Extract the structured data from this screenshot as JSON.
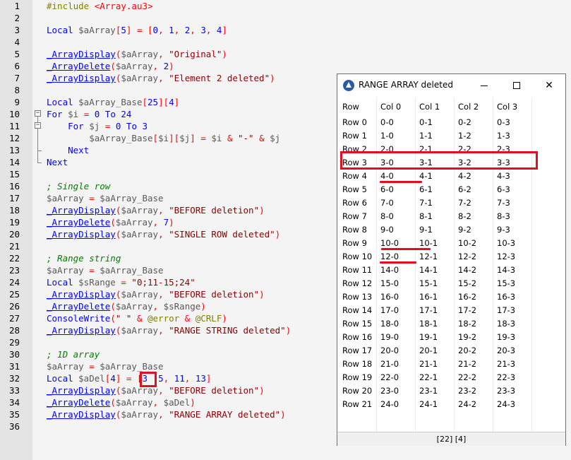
{
  "editor": {
    "lines": [
      [
        [
          "inc",
          "#include "
        ],
        [
          "str",
          "<Array.au3>"
        ]
      ],
      [],
      [
        [
          "kw",
          "Local "
        ],
        [
          "var",
          "$aArray"
        ],
        [
          "op",
          "["
        ],
        [
          "num",
          "5"
        ],
        [
          "op",
          "] = ["
        ],
        [
          "num",
          "0"
        ],
        [
          "op",
          ", "
        ],
        [
          "num",
          "1"
        ],
        [
          "op",
          ", "
        ],
        [
          "num",
          "2"
        ],
        [
          "op",
          ", "
        ],
        [
          "num",
          "3"
        ],
        [
          "op",
          ", "
        ],
        [
          "num",
          "4"
        ],
        [
          "op",
          "]"
        ]
      ],
      [],
      [
        [
          "fn",
          "_ArrayDisplay"
        ],
        [
          "op",
          "("
        ],
        [
          "var",
          "$aArray"
        ],
        [
          "op",
          ", "
        ],
        [
          "strd",
          "\"Original\""
        ],
        [
          "op",
          ")"
        ]
      ],
      [
        [
          "fn",
          "_ArrayDelete"
        ],
        [
          "op",
          "("
        ],
        [
          "var",
          "$aArray"
        ],
        [
          "op",
          ", "
        ],
        [
          "num",
          "2"
        ],
        [
          "op",
          ")"
        ]
      ],
      [
        [
          "fn",
          "_ArrayDisplay"
        ],
        [
          "op",
          "("
        ],
        [
          "var",
          "$aArray"
        ],
        [
          "op",
          ", "
        ],
        [
          "strd",
          "\"Element 2 deleted\""
        ],
        [
          "op",
          ")"
        ]
      ],
      [],
      [
        [
          "kw",
          "Local "
        ],
        [
          "var",
          "$aArray_Base"
        ],
        [
          "op",
          "["
        ],
        [
          "num",
          "25"
        ],
        [
          "op",
          "]["
        ],
        [
          "num",
          "4"
        ],
        [
          "op",
          "]"
        ]
      ],
      [
        [
          "kw",
          "For "
        ],
        [
          "var",
          "$i"
        ],
        [
          "op",
          " = "
        ],
        [
          "num",
          "0"
        ],
        [
          "kw",
          " To "
        ],
        [
          "num",
          "24"
        ]
      ],
      [
        [
          "plain",
          "    "
        ],
        [
          "kw",
          "For "
        ],
        [
          "var",
          "$j"
        ],
        [
          "op",
          " = "
        ],
        [
          "num",
          "0"
        ],
        [
          "kw",
          " To "
        ],
        [
          "num",
          "3"
        ]
      ],
      [
        [
          "plain",
          "        "
        ],
        [
          "var",
          "$aArray_Base"
        ],
        [
          "op",
          "["
        ],
        [
          "var",
          "$i"
        ],
        [
          "op",
          "]["
        ],
        [
          "var",
          "$j"
        ],
        [
          "op",
          "] = "
        ],
        [
          "var",
          "$i"
        ],
        [
          "op",
          " & "
        ],
        [
          "strd",
          "\"-\""
        ],
        [
          "op",
          " & "
        ],
        [
          "var",
          "$j"
        ]
      ],
      [
        [
          "plain",
          "    "
        ],
        [
          "kw",
          "Next"
        ]
      ],
      [
        [
          "kw",
          "Next"
        ]
      ],
      [],
      [
        [
          "cmt",
          "; Single row"
        ]
      ],
      [
        [
          "var",
          "$aArray"
        ],
        [
          "op",
          " = "
        ],
        [
          "var",
          "$aArray_Base"
        ]
      ],
      [
        [
          "fn",
          "_ArrayDisplay"
        ],
        [
          "op",
          "("
        ],
        [
          "var",
          "$aArray"
        ],
        [
          "op",
          ", "
        ],
        [
          "strd",
          "\"BEFORE deletion\""
        ],
        [
          "op",
          ")"
        ]
      ],
      [
        [
          "fn",
          "_ArrayDelete"
        ],
        [
          "op",
          "("
        ],
        [
          "var",
          "$aArray"
        ],
        [
          "op",
          ", "
        ],
        [
          "num",
          "7"
        ],
        [
          "op",
          ")"
        ]
      ],
      [
        [
          "fn",
          "_ArrayDisplay"
        ],
        [
          "op",
          "("
        ],
        [
          "var",
          "$aArray"
        ],
        [
          "op",
          ", "
        ],
        [
          "strd",
          "\"SINGLE ROW deleted\""
        ],
        [
          "op",
          ")"
        ]
      ],
      [],
      [
        [
          "cmt",
          "; Range string"
        ]
      ],
      [
        [
          "var",
          "$aArray"
        ],
        [
          "op",
          " = "
        ],
        [
          "var",
          "$aArray_Base"
        ]
      ],
      [
        [
          "kw",
          "Local "
        ],
        [
          "var",
          "$sRange"
        ],
        [
          "op",
          " = "
        ],
        [
          "strd",
          "\"0;11-15;24\""
        ]
      ],
      [
        [
          "fn",
          "_ArrayDisplay"
        ],
        [
          "op",
          "("
        ],
        [
          "var",
          "$aArray"
        ],
        [
          "op",
          ", "
        ],
        [
          "strd",
          "\"BEFORE deletion\""
        ],
        [
          "op",
          ")"
        ]
      ],
      [
        [
          "fn",
          "_ArrayDelete"
        ],
        [
          "op",
          "("
        ],
        [
          "var",
          "$aArray"
        ],
        [
          "op",
          ", "
        ],
        [
          "var",
          "$sRange"
        ],
        [
          "op",
          ")"
        ]
      ],
      [
        [
          "kw",
          "ConsoleWrite"
        ],
        [
          "op",
          "("
        ],
        [
          "strd",
          "\" \""
        ],
        [
          "op",
          " & "
        ],
        [
          "macro",
          "@error"
        ],
        [
          "op",
          " & "
        ],
        [
          "macro",
          "@CRLF"
        ],
        [
          "op",
          ")"
        ]
      ],
      [
        [
          "fn",
          "_ArrayDisplay"
        ],
        [
          "op",
          "("
        ],
        [
          "var",
          "$aArray"
        ],
        [
          "op",
          ", "
        ],
        [
          "strd",
          "\"RANGE STRING deleted\""
        ],
        [
          "op",
          ")"
        ]
      ],
      [],
      [
        [
          "cmt",
          "; 1D array"
        ]
      ],
      [
        [
          "var",
          "$aArray"
        ],
        [
          "op",
          " = "
        ],
        [
          "var",
          "$aArray_Base"
        ]
      ],
      [
        [
          "kw",
          "Local "
        ],
        [
          "var",
          "$aDel"
        ],
        [
          "op",
          "["
        ],
        [
          "num",
          "4"
        ],
        [
          "op",
          "] = ["
        ],
        [
          "num",
          "3"
        ],
        [
          "op",
          "  "
        ],
        [
          "num",
          "5"
        ],
        [
          "op",
          ", "
        ],
        [
          "num",
          "11"
        ],
        [
          "op",
          ", "
        ],
        [
          "num",
          "13"
        ],
        [
          "op",
          "]"
        ]
      ],
      [
        [
          "fn",
          "_ArrayDisplay"
        ],
        [
          "op",
          "("
        ],
        [
          "var",
          "$aArray"
        ],
        [
          "op",
          ", "
        ],
        [
          "strd",
          "\"BEFORE deletion\""
        ],
        [
          "op",
          ")"
        ]
      ],
      [
        [
          "fn",
          "_ArrayDelete"
        ],
        [
          "op",
          "("
        ],
        [
          "var",
          "$aArray"
        ],
        [
          "op",
          ", "
        ],
        [
          "var",
          "$aDel"
        ],
        [
          "op",
          ")"
        ]
      ],
      [
        [
          "fn",
          "_ArrayDisplay"
        ],
        [
          "op",
          "("
        ],
        [
          "var",
          "$aArray"
        ],
        [
          "op",
          ", "
        ],
        [
          "strd",
          "\"RANGE ARRAY deleted\""
        ],
        [
          "op",
          ")"
        ]
      ],
      []
    ]
  },
  "window": {
    "title": "RANGE ARRAY deleted",
    "buttons": {
      "minimize": "—",
      "maximize": "□",
      "close": "✕"
    },
    "headers": [
      "Row",
      "Col 0",
      "Col 1",
      "Col 2",
      "Col 3"
    ],
    "rows": [
      [
        "Row 0",
        "0-0",
        "0-1",
        "0-2",
        "0-3"
      ],
      [
        "Row 1",
        "1-0",
        "1-1",
        "1-2",
        "1-3"
      ],
      [
        "Row 2",
        "2-0",
        "2-1",
        "2-2",
        "2-3"
      ],
      [
        "Row 3",
        "3-0",
        "3-1",
        "3-2",
        "3-3"
      ],
      [
        "Row 4",
        "4-0",
        "4-1",
        "4-2",
        "4-3"
      ],
      [
        "Row 5",
        "6-0",
        "6-1",
        "6-2",
        "6-3"
      ],
      [
        "Row 6",
        "7-0",
        "7-1",
        "7-2",
        "7-3"
      ],
      [
        "Row 7",
        "8-0",
        "8-1",
        "8-2",
        "8-3"
      ],
      [
        "Row 8",
        "9-0",
        "9-1",
        "9-2",
        "9-3"
      ],
      [
        "Row 9",
        "10-0",
        "10-1",
        "10-2",
        "10-3"
      ],
      [
        "Row 10",
        "12-0",
        "12-1",
        "12-2",
        "12-3"
      ],
      [
        "Row 11",
        "14-0",
        "14-1",
        "14-2",
        "14-3"
      ],
      [
        "Row 12",
        "15-0",
        "15-1",
        "15-2",
        "15-3"
      ],
      [
        "Row 13",
        "16-0",
        "16-1",
        "16-2",
        "16-3"
      ],
      [
        "Row 14",
        "17-0",
        "17-1",
        "17-2",
        "17-3"
      ],
      [
        "Row 15",
        "18-0",
        "18-1",
        "18-2",
        "18-3"
      ],
      [
        "Row 16",
        "19-0",
        "19-1",
        "19-2",
        "19-3"
      ],
      [
        "Row 17",
        "20-0",
        "20-1",
        "20-2",
        "20-3"
      ],
      [
        "Row 18",
        "21-0",
        "21-1",
        "21-2",
        "21-3"
      ],
      [
        "Row 19",
        "22-0",
        "22-1",
        "22-2",
        "22-3"
      ],
      [
        "Row 20",
        "23-0",
        "23-1",
        "23-2",
        "23-3"
      ],
      [
        "Row 21",
        "24-0",
        "24-1",
        "24-2",
        "24-3"
      ]
    ],
    "status": "[22] [4]"
  },
  "colors": {
    "annotation": "#e01020",
    "keyword": "#0000ff",
    "string": "#8b0000",
    "comment": "#008000"
  }
}
